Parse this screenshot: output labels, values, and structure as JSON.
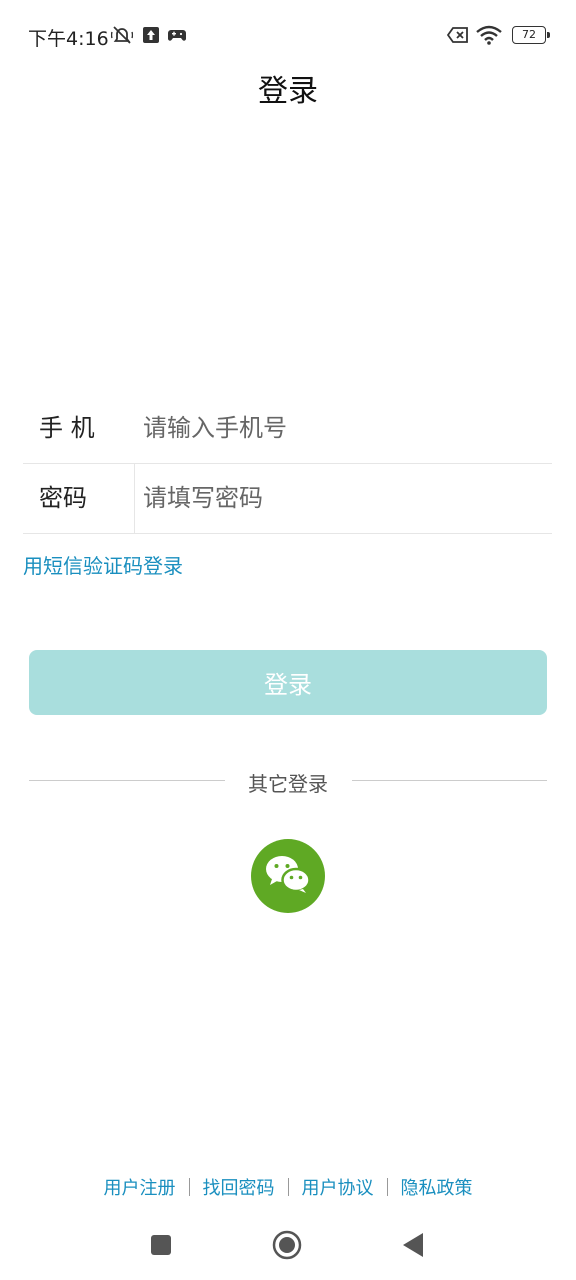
{
  "status_bar": {
    "time": "下午4:16",
    "battery": "72",
    "icons": [
      "mute-bell-icon",
      "upload-icon",
      "gamepad-icon",
      "sim-off-icon",
      "wifi-icon",
      "battery-icon"
    ]
  },
  "page": {
    "title": "登录"
  },
  "form": {
    "phone_label": "手 机",
    "phone_placeholder": "请输入手机号",
    "password_label": "密码",
    "password_placeholder": "请填写密码",
    "sms_login_link": "用短信验证码登录"
  },
  "login_button": "登录",
  "other_login": {
    "label": "其它登录",
    "icons": [
      "wechat-icon"
    ]
  },
  "footer": {
    "links": [
      "用户注册",
      "找回密码",
      "用户协议",
      "隐私政策"
    ]
  },
  "colors": {
    "accent_link": "#1a8fbf",
    "login_button_bg": "#a9dedd",
    "wechat_green": "#5fa924"
  }
}
